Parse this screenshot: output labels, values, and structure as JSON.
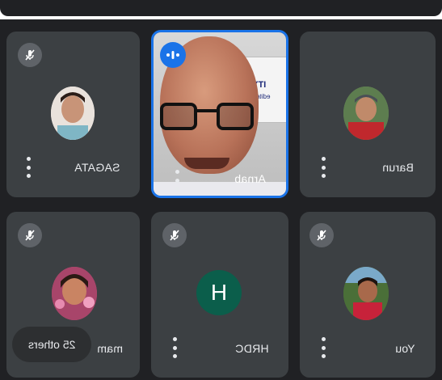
{
  "participants": [
    {
      "id": "sagata",
      "name": "SAGATA",
      "muted": true
    },
    {
      "id": "arnab",
      "name": "Arnab",
      "speaking": true,
      "banner": "ITY OF",
      "banner_sub": "edited by N"
    },
    {
      "id": "barun",
      "name": "Barun",
      "muted": true
    },
    {
      "id": "mam",
      "name": "mam",
      "muted": true
    },
    {
      "id": "hrdc",
      "name": "HRDC",
      "initial": "H",
      "muted": true
    },
    {
      "id": "you",
      "name": "You",
      "muted": true
    }
  ],
  "others_pill": {
    "label": "25 others"
  },
  "colors": {
    "tile_bg": "#3c4043",
    "grid_bg": "#202124",
    "accent": "#1a73e8",
    "hrdc_avatar": "#0b5e4b",
    "mic_off_bg": "#5f6368"
  },
  "icons": {
    "mic_off": "microphone-off-icon",
    "speaking": "audio-wave-icon",
    "more": "three-dots-vertical-icon"
  }
}
